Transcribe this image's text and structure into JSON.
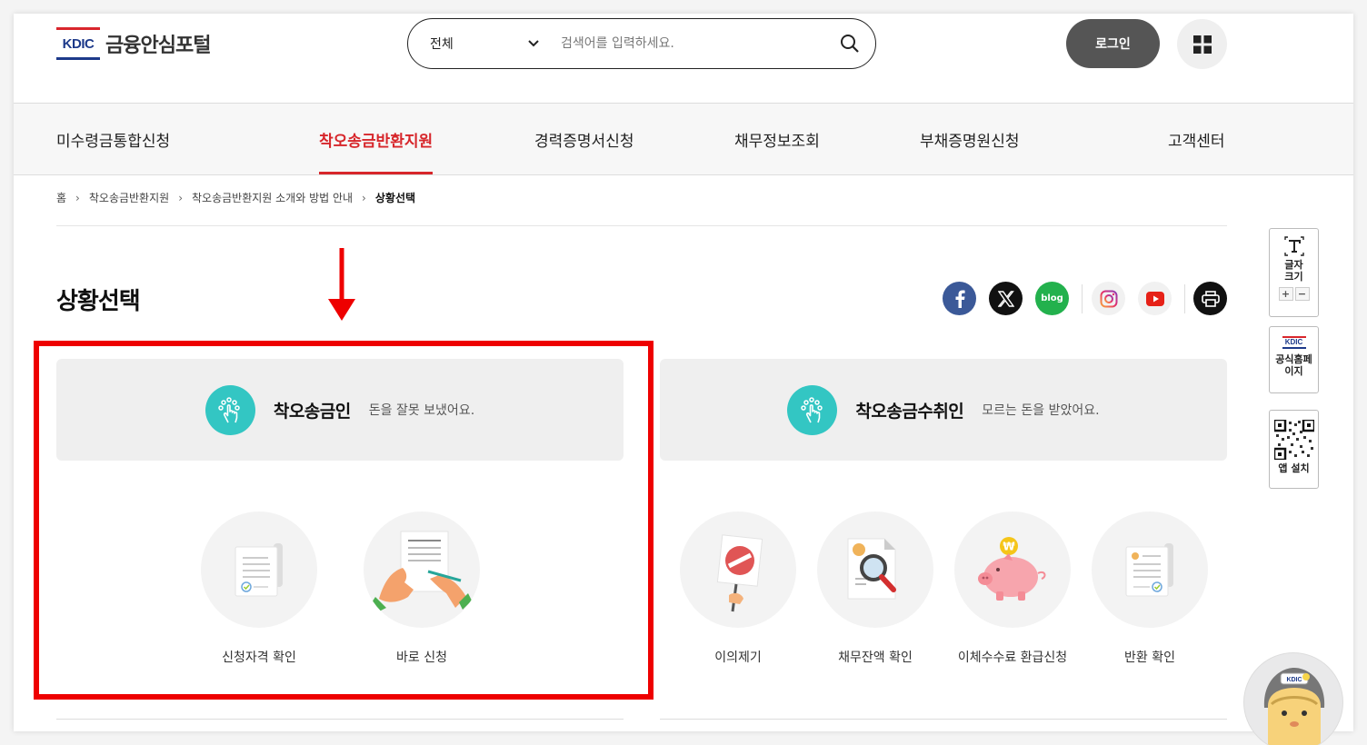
{
  "header": {
    "logo_mark": "KDIC",
    "logo_text": "금융안심포털",
    "search": {
      "scope": "전체",
      "placeholder": "검색어를 입력하세요."
    },
    "login_label": "로그인"
  },
  "gnb": [
    {
      "label": "미수령금통합신청",
      "active": false
    },
    {
      "label": "착오송금반환지원",
      "active": true
    },
    {
      "label": "경력증명서신청",
      "active": false
    },
    {
      "label": "채무정보조회",
      "active": false
    },
    {
      "label": "부채증명원신청",
      "active": false
    },
    {
      "label": "고객센터",
      "active": false
    }
  ],
  "breadcrumb": [
    "홈",
    "착오송금반환지원",
    "착오송금반환지원 소개와 방법 안내",
    "상황선택"
  ],
  "page_title": "상황선택",
  "sns": [
    "facebook-icon",
    "x-icon",
    "blog-icon",
    "instagram-icon",
    "youtube-icon",
    "print-icon"
  ],
  "sns_labels": {
    "blog": "blog"
  },
  "sender": {
    "title": "착오송금인",
    "desc": "돈을 잘못 보냈어요.",
    "actions": [
      "신청자격 확인",
      "바로 신청"
    ]
  },
  "receiver": {
    "title": "착오송금수취인",
    "desc": "모르는 돈을 받았어요.",
    "actions": [
      "이의제기",
      "채무잔액 확인",
      "이체수수료 환급신청",
      "반환 확인"
    ]
  },
  "side": {
    "font_size_label": "글자크기",
    "font_plus": "+",
    "font_minus": "−",
    "official_mark": "KDIC",
    "official_label": "공식홈페이지",
    "app_label": "앱 설치"
  },
  "colors": {
    "accent": "#d7262b",
    "teal": "#33c6c3",
    "highlight": "#ee0000"
  }
}
